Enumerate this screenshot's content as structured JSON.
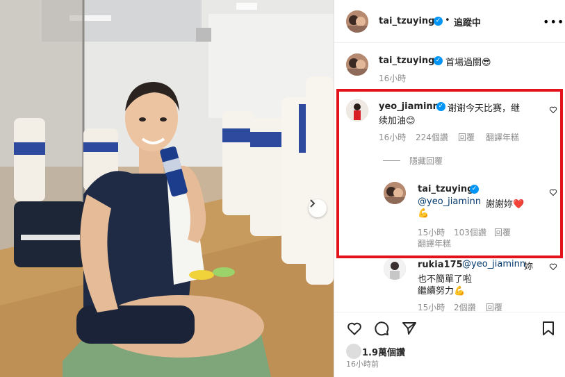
{
  "header": {
    "username": "tai_tzuying",
    "separator": "•",
    "follow_status": "追蹤中",
    "more_icon": "more-horizontal-icon"
  },
  "caption": {
    "username": "tai_tzuying",
    "text": "首場過關😎",
    "time": "16小時"
  },
  "comment1": {
    "username": "yeo_jiaminn",
    "text_line1": "谢谢今天比赛，继",
    "text_line2": "续加油😊",
    "time": "16小時",
    "likes": "224個讚",
    "reply": "回覆",
    "translate": "翻譯年糕",
    "hide_replies": "隱藏回覆"
  },
  "reply1": {
    "username": "tai_tzuying",
    "mention": "@yeo_jiaminn",
    "text": "謝謝妳❤️",
    "emoji_line2": "💪",
    "time": "15小時",
    "likes": "103個讚",
    "reply": "回覆",
    "translate": "翻譯年糕"
  },
  "comment2": {
    "username": "rukia175",
    "mention": "@yeo_jiaminn",
    "text_tail": "妳",
    "line2": "也不簡單了啦",
    "line3": "繼續努力💪",
    "time": "15小時",
    "likes": "2個讚",
    "reply": "回覆"
  },
  "footer": {
    "like_count": "1.9萬個讚",
    "time": "16小時前"
  },
  "colors": {
    "highlight_border": "#e3131b",
    "verified": "#0095f6",
    "heart": "#ed1c24"
  }
}
